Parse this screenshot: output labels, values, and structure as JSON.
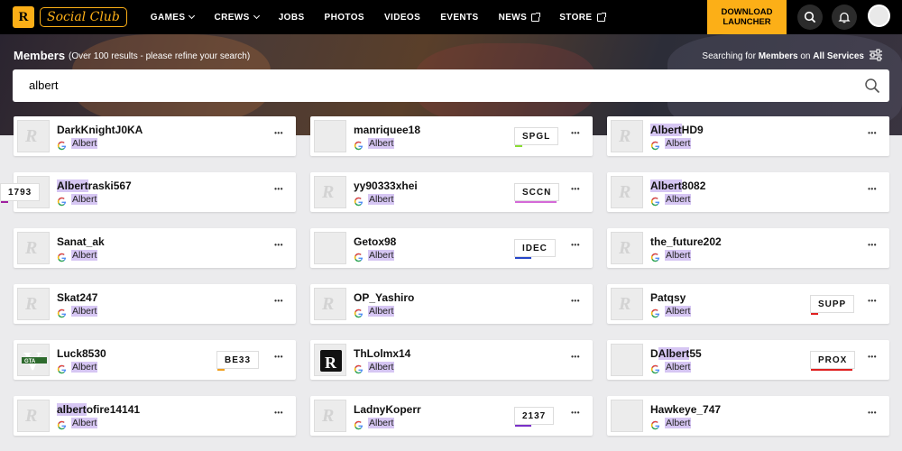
{
  "nav": {
    "logo_text": "Social Club",
    "logo_badge": "R",
    "menu": [
      {
        "label": "GAMES",
        "suffix": "chevron"
      },
      {
        "label": "CREWS",
        "suffix": "chevron"
      },
      {
        "label": "JOBS",
        "suffix": ""
      },
      {
        "label": "PHOTOS",
        "suffix": ""
      },
      {
        "label": "VIDEOS",
        "suffix": ""
      },
      {
        "label": "EVENTS",
        "suffix": ""
      },
      {
        "label": "NEWS",
        "suffix": "external"
      },
      {
        "label": "STORE",
        "suffix": "external"
      }
    ],
    "download_line1": "DOWNLOAD",
    "download_line2": "LAUNCHER"
  },
  "header": {
    "title": "Members",
    "note": "(Over 100 results - please refine your search)",
    "searching_prefix": "Searching for",
    "searching_members": "Members",
    "searching_on": "on",
    "searching_services": "All Services"
  },
  "search": {
    "value": "albert"
  },
  "colors": {
    "accent": "#fcaf17",
    "highlight": "#d6c6f3"
  },
  "results": [
    [
      {
        "pre": "",
        "hl": "",
        "post": "DarkKnightJ0KA",
        "alias": "Albert",
        "avatar": "default",
        "tag": "",
        "tag_color": "",
        "tag_bar_w": 0
      },
      {
        "pre": "",
        "hl": "Albert",
        "post": "raski567",
        "alias": "Albert",
        "avatar": "default",
        "tag": "1793",
        "tag_color": "#a020a0",
        "tag_bar_w": 8
      },
      {
        "pre": "",
        "hl": "",
        "post": "Sanat_ak",
        "alias": "Albert",
        "avatar": "default",
        "tag": "",
        "tag_color": "",
        "tag_bar_w": 0
      },
      {
        "pre": "",
        "hl": "",
        "post": "Skat247",
        "alias": "Albert",
        "avatar": "default",
        "tag": "",
        "tag_color": "",
        "tag_bar_w": 0
      },
      {
        "pre": "",
        "hl": "",
        "post": "Luck8530",
        "alias": "Albert",
        "avatar": "gta",
        "tag": "BE33",
        "tag_color": "#f0a020",
        "tag_bar_w": 8
      },
      {
        "pre": "",
        "hl": "albert",
        "post": "ofire14141",
        "alias": "Albert",
        "avatar": "default",
        "tag": "",
        "tag_color": "",
        "tag_bar_w": 0
      }
    ],
    [
      {
        "pre": "",
        "hl": "",
        "post": "manriquee18",
        "alias": "Albert",
        "avatar": "img1",
        "tag": "SPGL",
        "tag_color": "#88dd33",
        "tag_bar_w": 8
      },
      {
        "pre": "",
        "hl": "",
        "post": "yy90333xhei",
        "alias": "Albert",
        "avatar": "default",
        "tag": "SCCN",
        "tag_color": "#d56ad8",
        "tag_bar_w": 46
      },
      {
        "pre": "",
        "hl": "",
        "post": "Getox98",
        "alias": "Albert",
        "avatar": "img2",
        "tag": "IDEC",
        "tag_color": "#2545c8",
        "tag_bar_w": 18
      },
      {
        "pre": "",
        "hl": "",
        "post": "OP_Yashiro",
        "alias": "Albert",
        "avatar": "default",
        "tag": "",
        "tag_color": "",
        "tag_bar_w": 0
      },
      {
        "pre": "",
        "hl": "",
        "post": "ThLolmx14",
        "alias": "Albert",
        "avatar": "purple",
        "tag": "",
        "tag_color": "",
        "tag_bar_w": 0
      },
      {
        "pre": "",
        "hl": "",
        "post": "LadnyKoperr",
        "alias": "Albert",
        "avatar": "default",
        "tag": "2137",
        "tag_color": "#7a30c8",
        "tag_bar_w": 18
      }
    ],
    [
      {
        "pre": "",
        "hl": "Albert",
        "post": "HD9",
        "alias": "Albert",
        "avatar": "default",
        "tag": "",
        "tag_color": "",
        "tag_bar_w": 0
      },
      {
        "pre": "",
        "hl": "Albert",
        "post": "8082",
        "alias": "Albert",
        "avatar": "default",
        "tag": "",
        "tag_color": "",
        "tag_bar_w": 0
      },
      {
        "pre": "",
        "hl": "",
        "post": "the_future202",
        "alias": "Albert",
        "avatar": "default",
        "tag": "",
        "tag_color": "",
        "tag_bar_w": 0
      },
      {
        "pre": "",
        "hl": "",
        "post": "Patqsy",
        "alias": "Albert",
        "avatar": "default",
        "tag": "SUPP",
        "tag_color": "#e02020",
        "tag_bar_w": 8
      },
      {
        "pre": "D",
        "hl": "Albert",
        "post": "55",
        "alias": "Albert",
        "avatar": "racer",
        "tag": "PROX",
        "tag_color": "#e02020",
        "tag_bar_w": 46
      },
      {
        "pre": "",
        "hl": "",
        "post": "Hawkeye_747",
        "alias": "Albert",
        "avatar": "car",
        "tag": "",
        "tag_color": "",
        "tag_bar_w": 0
      }
    ]
  ]
}
